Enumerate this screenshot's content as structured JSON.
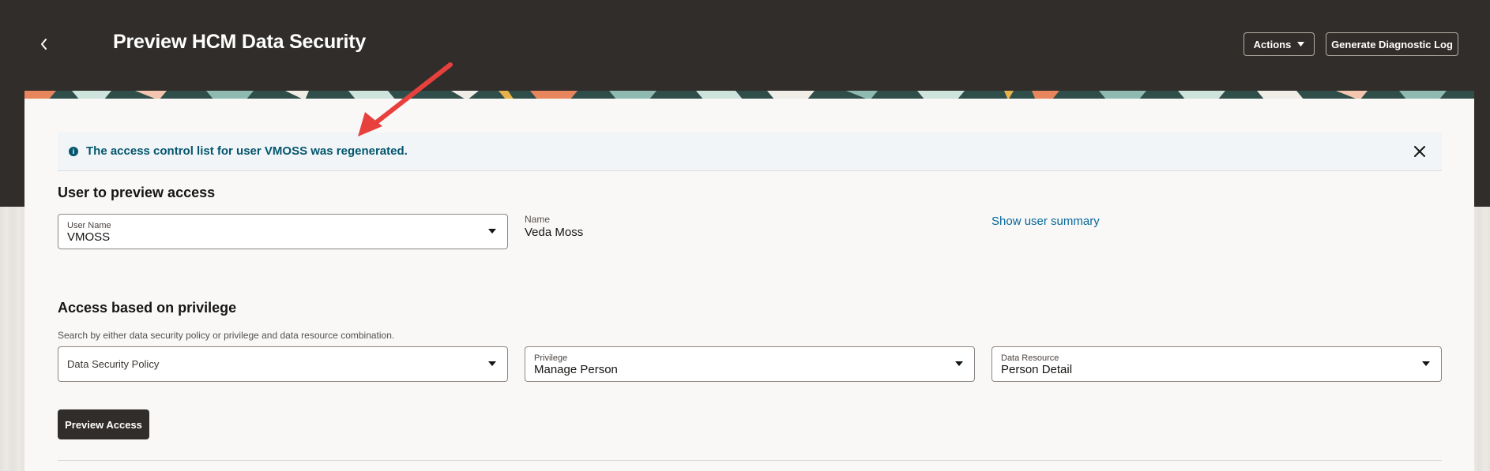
{
  "header": {
    "title": "Preview HCM Data Security",
    "actions_label": "Actions",
    "diagnostic_label": "Generate Diagnostic Log"
  },
  "message": {
    "text": "The access control list for user VMOSS was regenerated."
  },
  "user_section": {
    "title": "User to preview access",
    "user_name_label": "User Name",
    "user_name_value": "VMOSS",
    "name_label": "Name",
    "name_value": "Veda Moss",
    "summary_link": "Show user summary"
  },
  "privilege_section": {
    "title": "Access based on privilege",
    "help_text": "Search by either data security policy or privilege and data resource combination.",
    "policy_placeholder": "Data Security Policy",
    "privilege_label": "Privilege",
    "privilege_value": "Manage Person",
    "resource_label": "Data Resource",
    "resource_value": "Person Detail",
    "preview_button": "Preview Access"
  },
  "colors": {
    "header_bg": "#312d2a",
    "info_text": "#04566e",
    "link": "#04669a",
    "annotation_arrow": "#e8403d"
  },
  "icons": [
    "chevron-left-icon",
    "caret-down-icon",
    "info-icon",
    "close-icon",
    "annotation-arrow"
  ]
}
